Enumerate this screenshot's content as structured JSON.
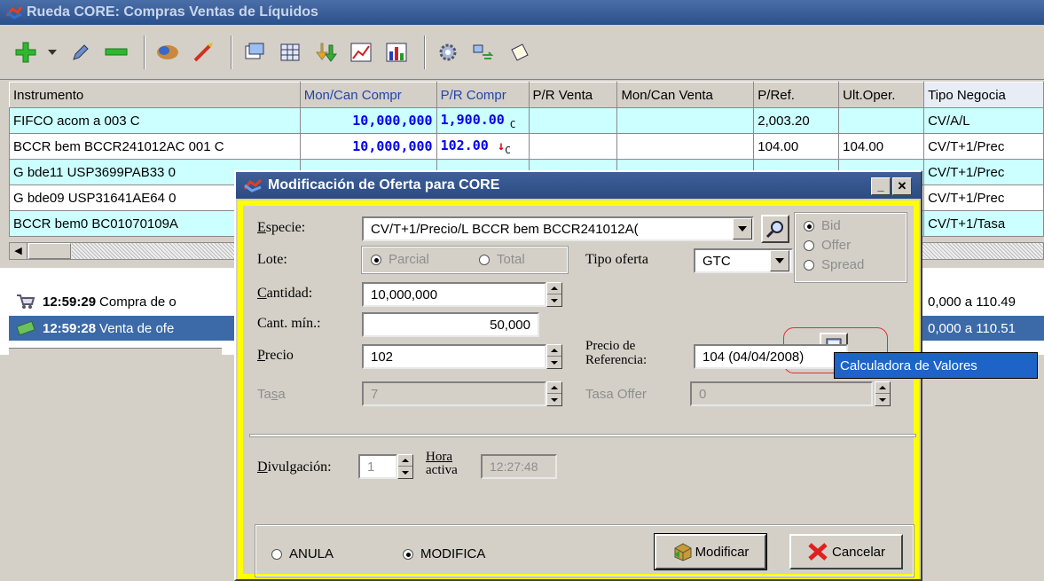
{
  "main_window": {
    "title": "Rueda CORE: Compras Ventas de Líquidos"
  },
  "toolbar": {
    "icons": [
      "add-icon",
      "dropdown-arrow-icon",
      "edit-pencil-icon",
      "remove-icon",
      "handshake-icon",
      "rocket-icon",
      "copy-icon",
      "calculator-grid-icon",
      "arrows-down-icon",
      "line-chart-icon",
      "bar-chart-icon",
      "settings-gear-icon",
      "transfer-icon",
      "note-icon"
    ]
  },
  "grid": {
    "columns": [
      "Instrumento",
      "Mon/Can Compr",
      "P/R Compr",
      "P/R Venta",
      "Mon/Can Venta",
      "P/Ref.",
      "Ult.Oper.",
      "Tipo Negocia"
    ],
    "rows": [
      {
        "instrumento": "FIFCO acom a 003 C",
        "mon_can_compr": "10,000,000",
        "pr_compr": "1,900.00",
        "pr_compr_sub": "C",
        "trend": "",
        "pr_venta": "",
        "mon_can_venta": "",
        "p_ref": "2,003.20",
        "ult_oper": "",
        "tipo": "CV/A/L"
      },
      {
        "instrumento": "BCCR bem BCCR241012AC 001 C",
        "mon_can_compr": "10,000,000",
        "pr_compr": "102.00",
        "pr_compr_sub": "C",
        "trend": "↓",
        "pr_venta": "",
        "mon_can_venta": "",
        "p_ref": "104.00",
        "ult_oper": "104.00",
        "tipo": "CV/T+1/Prec"
      },
      {
        "instrumento": "G bde11 USP3699PAB33 0",
        "mon_can_compr": "",
        "pr_compr": "",
        "pr_compr_sub": "",
        "trend": "",
        "pr_venta": "",
        "mon_can_venta": "",
        "p_ref": "",
        "ult_oper": "",
        "tipo": "CV/T+1/Prec"
      },
      {
        "instrumento": "G bde09 USP31641AE64 0",
        "mon_can_compr": "",
        "pr_compr": "",
        "pr_compr_sub": "",
        "trend": "",
        "pr_venta": "",
        "mon_can_venta": "",
        "p_ref": "",
        "ult_oper": "",
        "tipo": "CV/T+1/Prec"
      },
      {
        "instrumento": "BCCR bem0 BC01070109A",
        "mon_can_compr": "",
        "pr_compr": "",
        "pr_compr_sub": "",
        "trend": "",
        "pr_venta": "",
        "mon_can_venta": "",
        "p_ref": "",
        "ult_oper": "",
        "tipo": "CV/T+1/Tasa"
      }
    ]
  },
  "log": [
    {
      "time": "12:59:29",
      "text": "Compra de o",
      "tail": "0,000 a 110.49",
      "icon": "cart-icon"
    },
    {
      "time": "12:59:28",
      "text": "Venta de ofe",
      "tail": "0,000 a 110.51",
      "icon": "money-icon"
    }
  ],
  "dialog": {
    "title": "Modificación de Oferta para CORE",
    "especie_label": "Especie:",
    "especie_value": "CV/T+1/Precio/L BCCR bem BCCR241012A(",
    "lote_label": "Lote:",
    "lote_parcial": "Parcial",
    "lote_total": "Total",
    "tipo_oferta_label": "Tipo oferta",
    "tipo_oferta_value": "GTC",
    "side_bid": "Bid",
    "side_offer": "Offer",
    "side_spread": "Spread",
    "cantidad_label": "Cantidad:",
    "cantidad_value": "10,000,000",
    "cant_min_label": "Cant. mín.:",
    "cant_min_value": "50,000",
    "precio_label": "Precio",
    "precio_value": "102",
    "precio_ref_label_1": "Precio de",
    "precio_ref_label_2": "Referencia:",
    "precio_ref_value": "104 (04/04/2008)",
    "tasa_label": "Tasa",
    "tasa_value": "7",
    "tasa_offer_label": "Tasa Offer",
    "tasa_offer_value": "0",
    "divulgacion_label": "Divulgación:",
    "divulgacion_value": "1",
    "hora_label_1": "Hora",
    "hora_label_2": "activa",
    "hora_value": "12:27:48",
    "anula_label": "ANULA",
    "modifica_label": "MODIFICA",
    "modificar_button": "Modificar",
    "cancelar_button": "Cancelar",
    "tooltip": "Calculadora de Valores"
  },
  "colors": {
    "row_cyan": "#ccffff",
    "dialog_border": "#ffff00",
    "title_bar": "#2b4f8c",
    "value_blue": "#0000ee"
  }
}
